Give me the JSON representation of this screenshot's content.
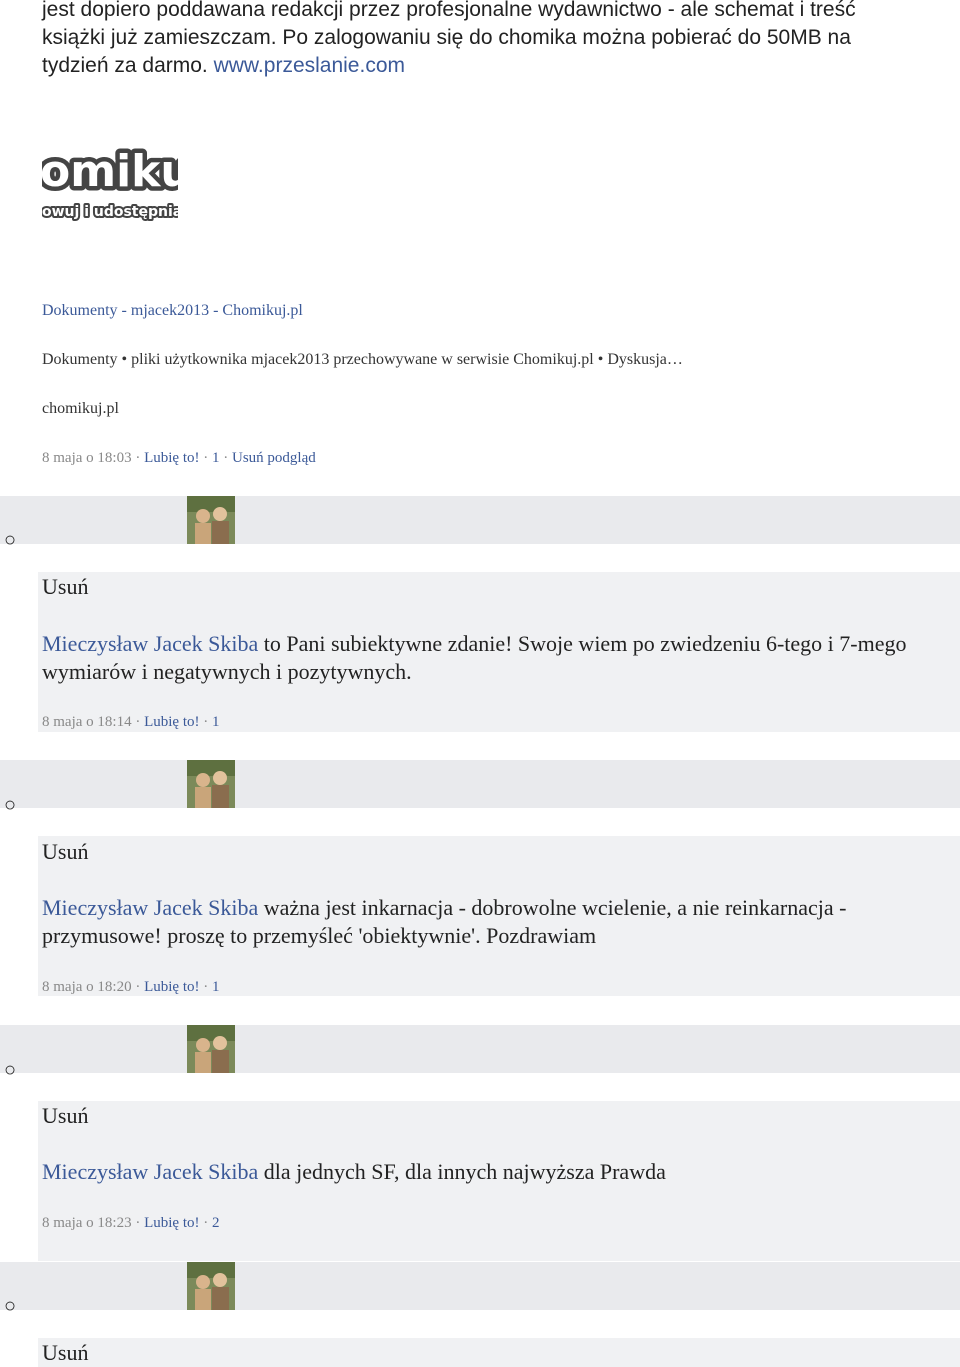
{
  "intro": {
    "text_1": "jest dopiero poddawana redakcji przez profesjonalne wydawnictwo - ale schemat i treść książki już zamieszczam. Po zalogowaniu się do chomika można pobierać do 50MB na tydzień za darmo.",
    "link": "www.przeslanie.com"
  },
  "logo": {
    "text_main": "omikuj",
    "text_sub": "owuj i udostępnia"
  },
  "share": {
    "title": "Dokumenty - mjacek2013 - Chomikuj.pl",
    "description": "Dokumenty • pliki użytkownika mjacek2013 przechowywane w serwisie Chomikuj.pl • Dyskusja…",
    "domain": "chomikuj.pl",
    "meta": {
      "time": "8 maja o 18:03",
      "like": "Lubię to!",
      "count": "1",
      "remove_preview": "Usuń podgląd"
    }
  },
  "bullet_symbol": "○",
  "comments": [
    {
      "remove": "Usuń",
      "author": "Mieczysław Jacek Skiba",
      "text": " to Pani subiektywne zdanie! Swoje wiem po zwiedzeniu 6-tego i 7-mego wymiarów i negatywnych i pozytywnych.",
      "time": "8 maja o 18:14",
      "like": "Lubię to!",
      "count": "1"
    },
    {
      "remove": "Usuń",
      "author": "Mieczysław Jacek Skiba",
      "text": " ważna jest inkarnacja - dobrowolne wcielenie, a nie reinkarnacja - przymusowe! proszę to przemyśleć 'obiektywnie'. Pozdrawiam",
      "time": "8 maja o 18:20",
      "like": "Lubię to!",
      "count": "1"
    },
    {
      "remove": "Usuń",
      "author": "Mieczysław Jacek Skiba",
      "text": " dla jednych SF, dla innych najwyższa Prawda",
      "time": "8 maja o 18:23",
      "like": "Lubię to!",
      "count": "2"
    },
    {
      "remove": "Usuń"
    }
  ],
  "colors": {
    "link": "#3b5998",
    "meta": "#888888",
    "bar": "#e9eaed",
    "comment_bg": "#f0f1f3"
  }
}
